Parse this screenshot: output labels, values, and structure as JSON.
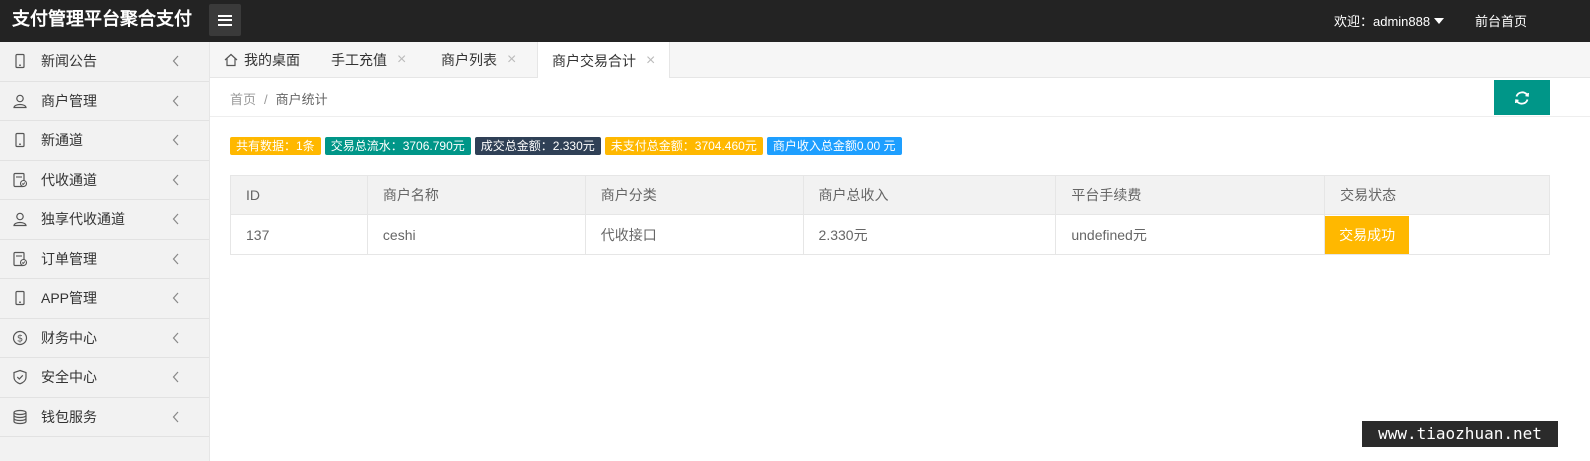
{
  "header": {
    "title": "支付管理平台聚合支付",
    "user_label": "欢迎：admin888",
    "front_link": "前台首页"
  },
  "sidebar": {
    "items": [
      {
        "label": "新闻公告",
        "icon": "phone-icon"
      },
      {
        "label": "商户管理",
        "icon": "user-icon"
      },
      {
        "label": "新通道",
        "icon": "phone-icon"
      },
      {
        "label": "代收通道",
        "icon": "form-icon"
      },
      {
        "label": "独享代收通道",
        "icon": "user-icon"
      },
      {
        "label": "订单管理",
        "icon": "form-icon"
      },
      {
        "label": "APP管理",
        "icon": "phone-icon"
      },
      {
        "label": "财务中心",
        "icon": "dollar-icon"
      },
      {
        "label": "安全中心",
        "icon": "shield-icon"
      },
      {
        "label": "钱包服务",
        "icon": "database-icon"
      }
    ]
  },
  "tabs": [
    {
      "label": "我的桌面",
      "closable": false,
      "active": false
    },
    {
      "label": "手工充值",
      "closable": true,
      "active": false
    },
    {
      "label": "商户列表",
      "closable": true,
      "active": false
    },
    {
      "label": "商户交易合计",
      "closable": true,
      "active": true
    }
  ],
  "tab_close_glyph": "×",
  "breadcrumb": {
    "home": "首页",
    "separator": "/",
    "current": "商户统计"
  },
  "badges": [
    {
      "text": "共有数据：1条",
      "color": "#FFB800"
    },
    {
      "text": "交易总流水：3706.790元",
      "color": "#009688"
    },
    {
      "text": "成交总金额：2.330元",
      "color": "#2F4056"
    },
    {
      "text": "未支付总金额：3704.460元",
      "color": "#FFB800"
    },
    {
      "text": "商户收入总金额0.00 元",
      "color": "#1E9FFF"
    }
  ],
  "table": {
    "headers": [
      "ID",
      "商户名称",
      "商户分类",
      "商户总收入",
      "平台手续费",
      "交易状态"
    ],
    "rows": [
      {
        "id": "137",
        "name": "ceshi",
        "category": "代收接口",
        "income": "2.330元",
        "fee": "undefined元",
        "status": "交易成功"
      }
    ]
  },
  "colors": {
    "accent": "#009688",
    "header_bg": "#232323",
    "status_warn": "#FFB800"
  },
  "watermark": "www.tiaozhuan.net"
}
